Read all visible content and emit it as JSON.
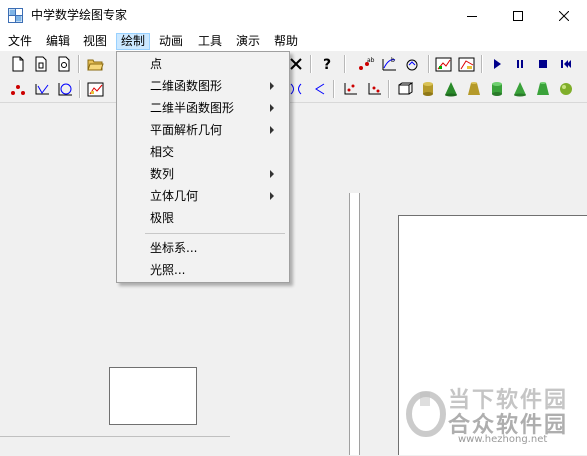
{
  "window": {
    "title": "中学数学绘图专家",
    "icon": "app-grid-icon",
    "controls": {
      "minimize": "minimize-icon",
      "maximize": "maximize-icon",
      "close": "close-icon"
    }
  },
  "menubar": {
    "items": [
      {
        "label": "文件",
        "active": false
      },
      {
        "label": "编辑",
        "active": false
      },
      {
        "label": "视图",
        "active": false
      },
      {
        "label": "绘制",
        "active": true
      },
      {
        "label": "动画",
        "active": false
      },
      {
        "label": "工具",
        "active": false
      },
      {
        "label": "演示",
        "active": false
      },
      {
        "label": "帮助",
        "active": false
      }
    ]
  },
  "toolbar1": {
    "icons": [
      "new-doc-icon",
      "new-doc2-icon",
      "new-doc3-icon",
      "open-folder-icon",
      "delete-x-icon",
      "help-question-icon",
      "points-ab-icon",
      "points-ab2-icon",
      "graph-curve-icon",
      "paint-graph-icon",
      "paint-graph2-icon",
      "play-icon",
      "pause-icon",
      "stop-icon",
      "skip-icon"
    ]
  },
  "toolbar2": {
    "icons": [
      "point-icon",
      "angle-icon",
      "circle-icon",
      "chart-icon",
      "hyperbola-icon",
      "curve-left-icon",
      "axes-icon",
      "axes2-icon",
      "cube-frame-icon",
      "cylinder-icon",
      "cone-icon",
      "frustum-icon",
      "cylinder2-icon",
      "cone2-icon",
      "frustum2-icon",
      "sphere-icon"
    ]
  },
  "dropdown": {
    "items": [
      {
        "label": "点",
        "submenu": false
      },
      {
        "label": "二维函数图形",
        "submenu": true
      },
      {
        "label": "二维半函数图形",
        "submenu": true
      },
      {
        "label": "平面解析几何",
        "submenu": true
      },
      {
        "label": "相交",
        "submenu": false
      },
      {
        "label": "数列",
        "submenu": true
      },
      {
        "label": "立体几何",
        "submenu": true
      },
      {
        "label": "极限",
        "submenu": false
      },
      {
        "label": "坐标系...",
        "submenu": false
      },
      {
        "label": "光照...",
        "submenu": false
      }
    ]
  },
  "watermark": {
    "line1": "当下软件园",
    "line2": "合众软件园",
    "line3": "www.hezhong.net"
  }
}
